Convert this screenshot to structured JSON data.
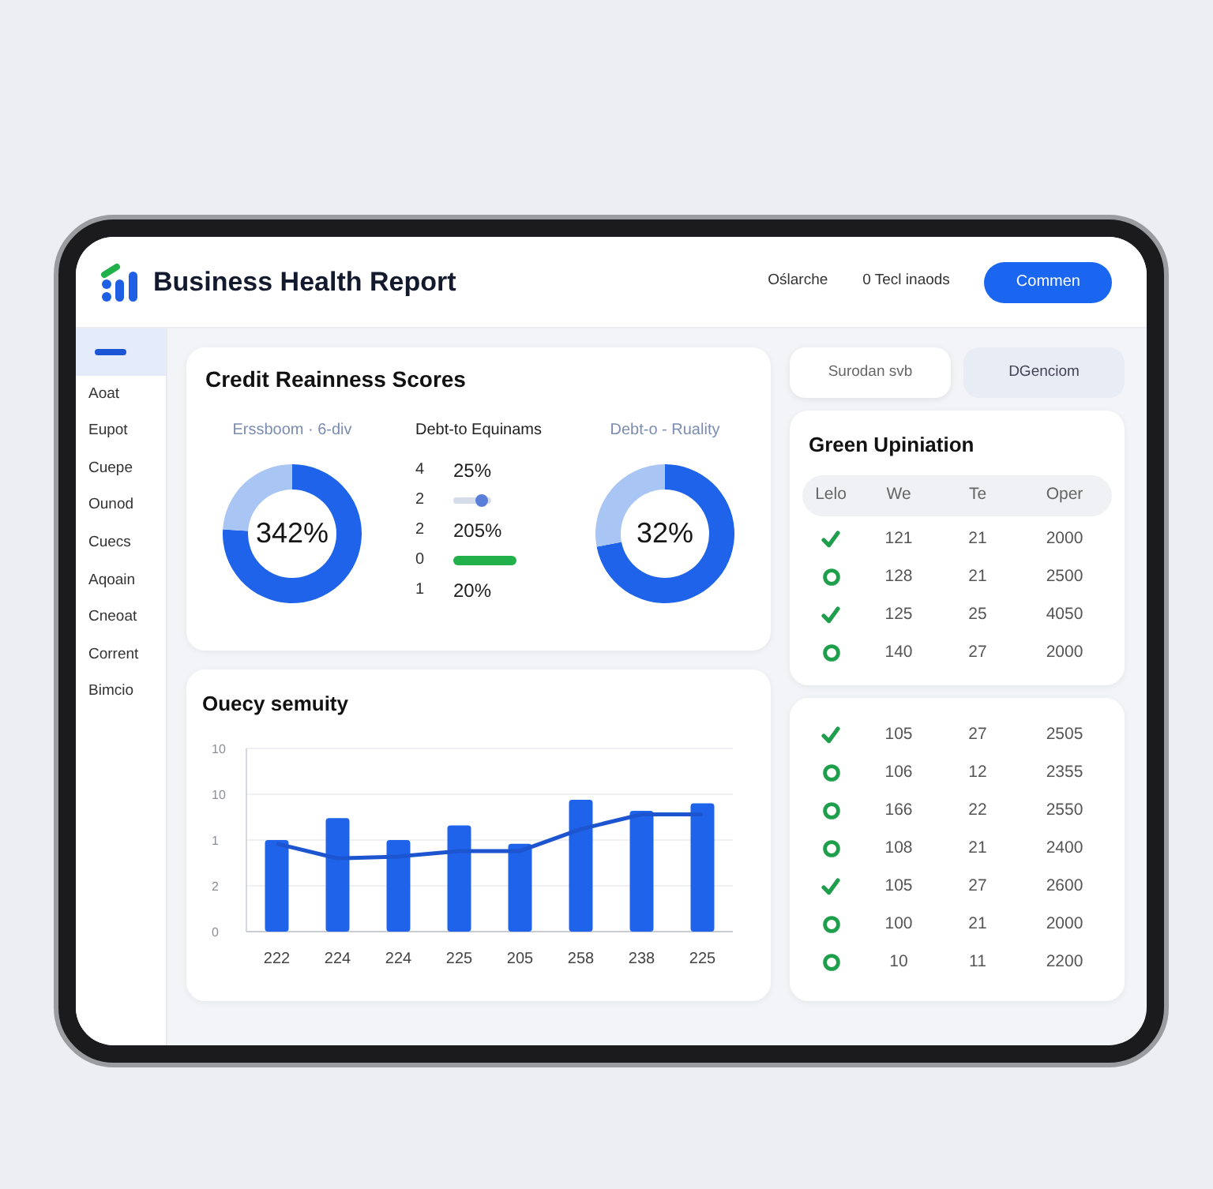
{
  "header": {
    "title": "Business Health Report",
    "links": [
      "Oślarche",
      "0 Tecl inaods"
    ],
    "button": "Commen"
  },
  "sidebar": {
    "items": [
      {
        "kind": "icon",
        "selected": true
      },
      {
        "kind": "text",
        "label": "Aoat",
        "selected": false
      },
      {
        "kind": "text",
        "label": "Eupot",
        "selected": false
      },
      {
        "kind": "text",
        "label": "Cuepe",
        "selected": false
      },
      {
        "kind": "text",
        "label": "Ounod",
        "selected": false
      },
      {
        "kind": "text",
        "label": "Cuecs",
        "selected": false
      },
      {
        "kind": "text",
        "label": "Aqoain",
        "selected": false
      },
      {
        "kind": "text",
        "label": "Cneoat",
        "selected": false
      },
      {
        "kind": "text",
        "label": "Corrent",
        "selected": false
      },
      {
        "kind": "text",
        "label": "Bimcio",
        "selected": false
      }
    ]
  },
  "credit_card": {
    "title": "Credit Reainness Scores",
    "gauges": [
      {
        "label": "Erssboom · 6-div",
        "value": "342%"
      },
      {
        "label": "Debt-o - Ruality",
        "value": "32%"
      }
    ],
    "list": {
      "title": "Debt-to Equinams",
      "rows": [
        {
          "kind": "text",
          "index": "4",
          "value": "25%"
        },
        {
          "kind": "slider",
          "index": "2",
          "level": 0.9
        },
        {
          "kind": "text",
          "index": "2",
          "value": "205%"
        },
        {
          "kind": "bar",
          "index": "0"
        },
        {
          "kind": "text",
          "index": "1",
          "value": "20%"
        }
      ]
    }
  },
  "chart_card": {
    "title": "Ouecy semuity",
    "y_labels": [
      "10",
      "10",
      "1",
      "2",
      "0"
    ],
    "x_labels": [
      "222",
      "224",
      "224",
      "225",
      "205",
      "258",
      "238",
      "225"
    ]
  },
  "tabs": [
    {
      "label": "Surodan svb",
      "selected": true
    },
    {
      "label": "DGenciom",
      "selected": false
    }
  ],
  "summary_table": {
    "title": "Green Upiniation",
    "status_header": "Lelo",
    "columns": [
      "We",
      "Te",
      "Oper"
    ],
    "rows": [
      {
        "checked": true,
        "cells": [
          "121",
          "21",
          "2000"
        ]
      },
      {
        "checked": false,
        "cells": [
          "128",
          "21",
          "2500"
        ]
      },
      {
        "checked": true,
        "cells": [
          "125",
          "25",
          "4050"
        ]
      },
      {
        "checked": false,
        "cells": [
          "140",
          "27",
          "2000"
        ]
      }
    ]
  },
  "detail_table": {
    "rows": [
      {
        "checked": true,
        "cells": [
          "105",
          "27",
          "2505"
        ]
      },
      {
        "checked": false,
        "cells": [
          "106",
          "12",
          "2355"
        ]
      },
      {
        "checked": false,
        "cells": [
          "166",
          "22",
          "2550"
        ]
      },
      {
        "checked": false,
        "cells": [
          "108",
          "21",
          "2400"
        ]
      },
      {
        "checked": true,
        "cells": [
          "105",
          "27",
          "2600"
        ]
      },
      {
        "checked": false,
        "cells": [
          "100",
          "21",
          "2000"
        ]
      },
      {
        "checked": false,
        "cells": [
          "10",
          "11",
          "2200"
        ]
      }
    ]
  }
}
